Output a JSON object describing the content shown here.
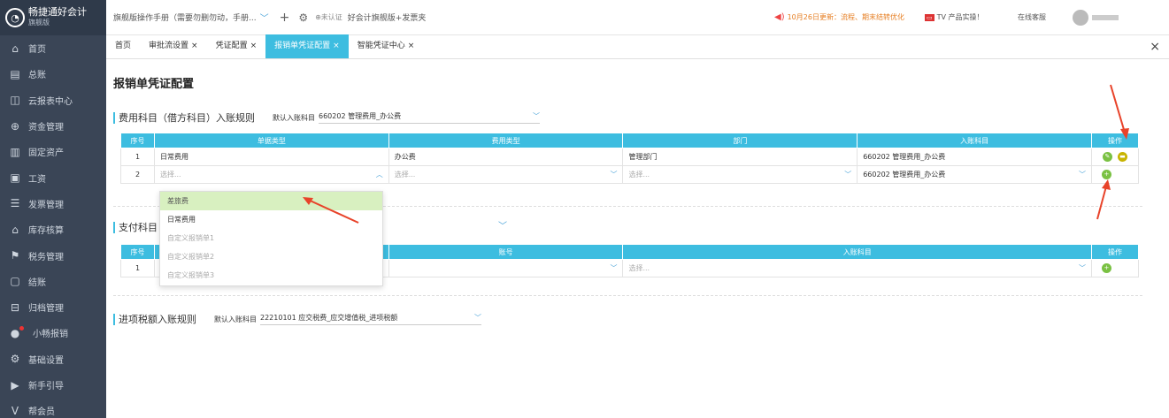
{
  "sidebar": {
    "logo": {
      "title": "畅捷通好会计",
      "sub": "旗舰版"
    },
    "items": [
      {
        "label": "首页",
        "icon": "home-icon",
        "glyph": "⌂"
      },
      {
        "label": "总账",
        "icon": "ledger-icon",
        "glyph": "▤"
      },
      {
        "label": "云报表中心",
        "icon": "chart-icon",
        "glyph": "◫"
      },
      {
        "label": "资金管理",
        "icon": "fund-icon",
        "glyph": "⊕"
      },
      {
        "label": "固定资产",
        "icon": "asset-icon",
        "glyph": "▥"
      },
      {
        "label": "工资",
        "icon": "salary-icon",
        "glyph": "▣"
      },
      {
        "label": "发票管理",
        "icon": "invoice-icon",
        "glyph": "☰"
      },
      {
        "label": "库存核算",
        "icon": "stock-icon",
        "glyph": "⌂"
      },
      {
        "label": "税务管理",
        "icon": "tax-icon",
        "glyph": "⚑"
      },
      {
        "label": "结账",
        "icon": "close-account-icon",
        "glyph": "▢"
      },
      {
        "label": "归档管理",
        "icon": "archive-icon",
        "glyph": "⊟"
      },
      {
        "label": "小畅报销",
        "icon": "reimburse-icon",
        "glyph": "●"
      },
      {
        "label": "基础设置",
        "icon": "settings-icon",
        "glyph": "⚙"
      },
      {
        "label": "新手引导",
        "icon": "guide-icon",
        "glyph": "▶"
      },
      {
        "label": "帮会员",
        "icon": "member-icon",
        "glyph": "V"
      }
    ]
  },
  "topbar": {
    "manual": "旗舰版操作手册（需要勿删勿动，手册...",
    "cert": "⊕未认证",
    "company": "好会计旗舰版+发票夹",
    "notice": "10月26日更新：流程、期末结转优化",
    "product": "TV 产品实操！",
    "service": "在线客服"
  },
  "tabs": [
    {
      "label": "首页",
      "closable": false,
      "active": false
    },
    {
      "label": "审批流设置",
      "closable": true,
      "active": false
    },
    {
      "label": "凭证配置",
      "closable": true,
      "active": false
    },
    {
      "label": "报销单凭证配置",
      "closable": true,
      "active": true
    },
    {
      "label": "智能凭证中心",
      "closable": true,
      "active": false
    }
  ],
  "page": {
    "title": "报销单凭证配置",
    "section1": {
      "title": "费用科目（借方科目）入账规则",
      "default_label": "默认入账科目",
      "default_value": "660202 管理费用_办公费",
      "headers": [
        "序号",
        "单据类型",
        "费用类型",
        "部门",
        "入账科目",
        "操作"
      ],
      "rows": [
        {
          "no": "1",
          "doc_type": "日常费用",
          "fee_type": "办公费",
          "dept": "管理部门",
          "account": "660202 管理费用_办公费"
        },
        {
          "no": "2",
          "doc_type": "选择...",
          "fee_type": "选择...",
          "dept": "选择...",
          "account": "660202 管理费用_办公费"
        }
      ]
    },
    "section2": {
      "title": "支付科目",
      "headers": [
        "序号",
        "",
        "账号",
        "入账科目",
        "操作"
      ],
      "rows": [
        {
          "no": "1",
          "account": "选择..."
        }
      ]
    },
    "section3": {
      "title": "进项税额入账规则",
      "default_label": "默认入账科目",
      "default_value": "22210101 应交税费_应交增值税_进项税额"
    },
    "dropdown": [
      "差旅费",
      "日常费用",
      "自定义报销单1",
      "自定义报销单2",
      "自定义报销单3"
    ]
  },
  "colors": {
    "accent": "#3dbde0",
    "sidebar": "#3a4556",
    "annotation": "#e8432a"
  }
}
